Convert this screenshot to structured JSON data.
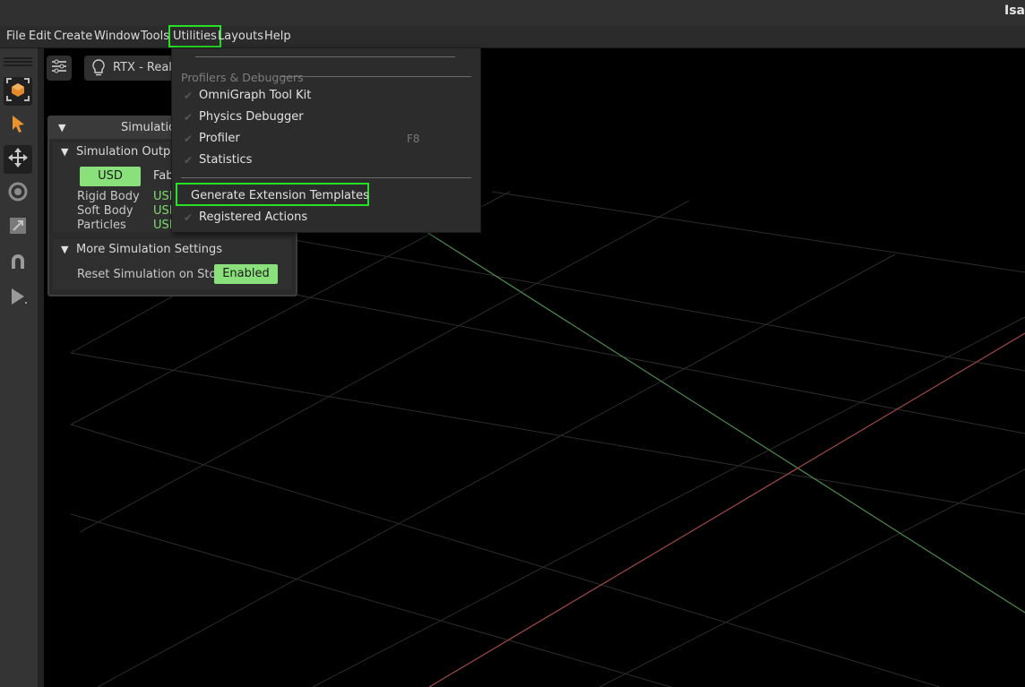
{
  "app": {
    "title": "Isa"
  },
  "menubar": {
    "items": [
      "File",
      "Edit",
      "Create",
      "Window",
      "Tools",
      "Utilities",
      "Layouts",
      "Help"
    ]
  },
  "viewport": {
    "render_mode": "RTX - Real-T"
  },
  "simulation_panel": {
    "title": "Simulation",
    "output_section": {
      "title": "Simulation Output",
      "usd_button": "USD",
      "fabric_label": "Fab",
      "rows": [
        {
          "label": "Rigid Body",
          "value": "USD"
        },
        {
          "label": "Soft Body",
          "value": "USD"
        },
        {
          "label": "Particles",
          "value": "USD"
        }
      ]
    },
    "more_section": {
      "title": "More Simulation Settings",
      "reset_label": "Reset Simulation on Stop",
      "reset_value": "Enabled"
    }
  },
  "utilities_menu": {
    "group_label": "Profilers & Debuggers",
    "items": [
      {
        "label": "OmniGraph Tool Kit"
      },
      {
        "label": "Physics Debugger"
      },
      {
        "label": "Profiler",
        "shortcut": "F8"
      },
      {
        "label": "Statistics"
      }
    ],
    "generate_label": "Generate Extension Templates",
    "registered_label": "Registered Actions"
  },
  "colors": {
    "highlight": "#27e127",
    "accent_green": "#8ae07a",
    "axis_x": "#a04848",
    "axis_z": "#4e8a4e",
    "grid": "#2e2e2e"
  }
}
